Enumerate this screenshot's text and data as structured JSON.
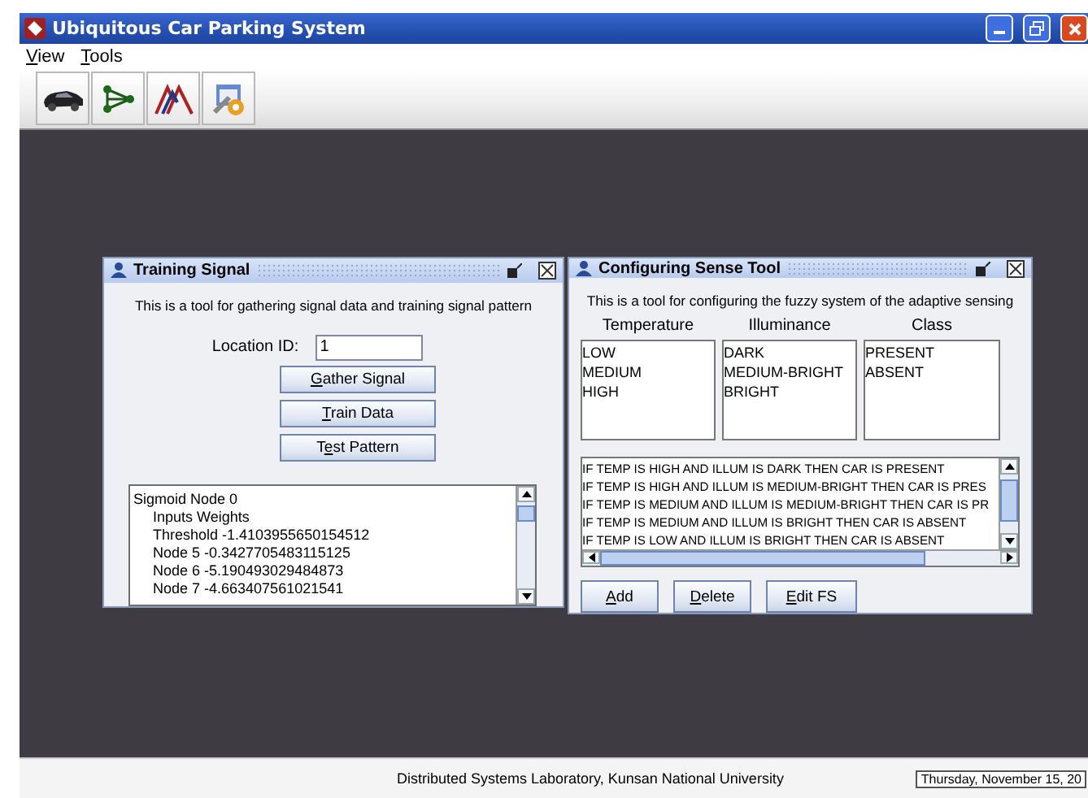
{
  "window": {
    "title": "Ubiquitous Car Parking System"
  },
  "menu": [
    {
      "key": "V",
      "after": "iew"
    },
    {
      "key": "T",
      "after": "ools"
    }
  ],
  "toolbar": [
    {
      "kind": "car"
    },
    {
      "kind": "nodes"
    },
    {
      "kind": "peaks"
    },
    {
      "kind": "tools"
    }
  ],
  "training_signal": {
    "title": "Training Signal",
    "description": "This is a tool for gathering signal data and training signal pattern",
    "location_label": "Location ID:",
    "location_value": "1",
    "buttons": [
      {
        "key": "G",
        "after": "ather Signal"
      },
      {
        "key": "T",
        "after": "rain Data"
      },
      {
        "before": "T",
        "key": "e",
        "after": "st Pattern"
      }
    ],
    "output": [
      {
        "text": "Sigmoid Node 0",
        "children": [
          {
            "text": "Inputs    Weights"
          },
          {
            "text": "Threshold    -1.4103955650154512"
          },
          {
            "text": "Node 5    -0.3427705483115125"
          },
          {
            "text": "Node 6    -5.190493029484873"
          },
          {
            "text": "Node 7    -4.663407561021541"
          }
        ]
      }
    ]
  },
  "sense_tool": {
    "title": "Configuring Sense Tool",
    "description": "This is a tool for configuring the fuzzy system of the adaptive sensing",
    "columns": [
      {
        "heading": "Temperature",
        "items": [
          "LOW",
          "MEDIUM",
          "HIGH"
        ]
      },
      {
        "heading": "Illuminance",
        "items": [
          "DARK",
          "MEDIUM-BRIGHT",
          "BRIGHT"
        ]
      },
      {
        "heading": "Class",
        "items": [
          "PRESENT",
          "ABSENT"
        ]
      }
    ],
    "rules": [
      "IF TEMP IS HIGH AND ILLUM IS DARK THEN CAR IS PRESENT",
      "IF TEMP IS HIGH AND ILLUM IS MEDIUM-BRIGHT THEN CAR IS PRES",
      "IF TEMP IS MEDIUM AND ILLUM IS MEDIUM-BRIGHT THEN CAR IS PR",
      "IF TEMP IS MEDIUM AND ILLUM IS BRIGHT THEN CAR IS ABSENT",
      "IF TEMP IS LOW AND ILLUM IS BRIGHT THEN CAR IS ABSENT"
    ],
    "buttons": [
      {
        "key": "A",
        "after": "dd"
      },
      {
        "key": "D",
        "after": "elete"
      },
      {
        "key": "E",
        "after": "dit FS"
      }
    ]
  },
  "status_bar": {
    "text": "Distributed Systems Laboratory, Kunsan National University",
    "date": "Thursday, November 15, 20"
  }
}
